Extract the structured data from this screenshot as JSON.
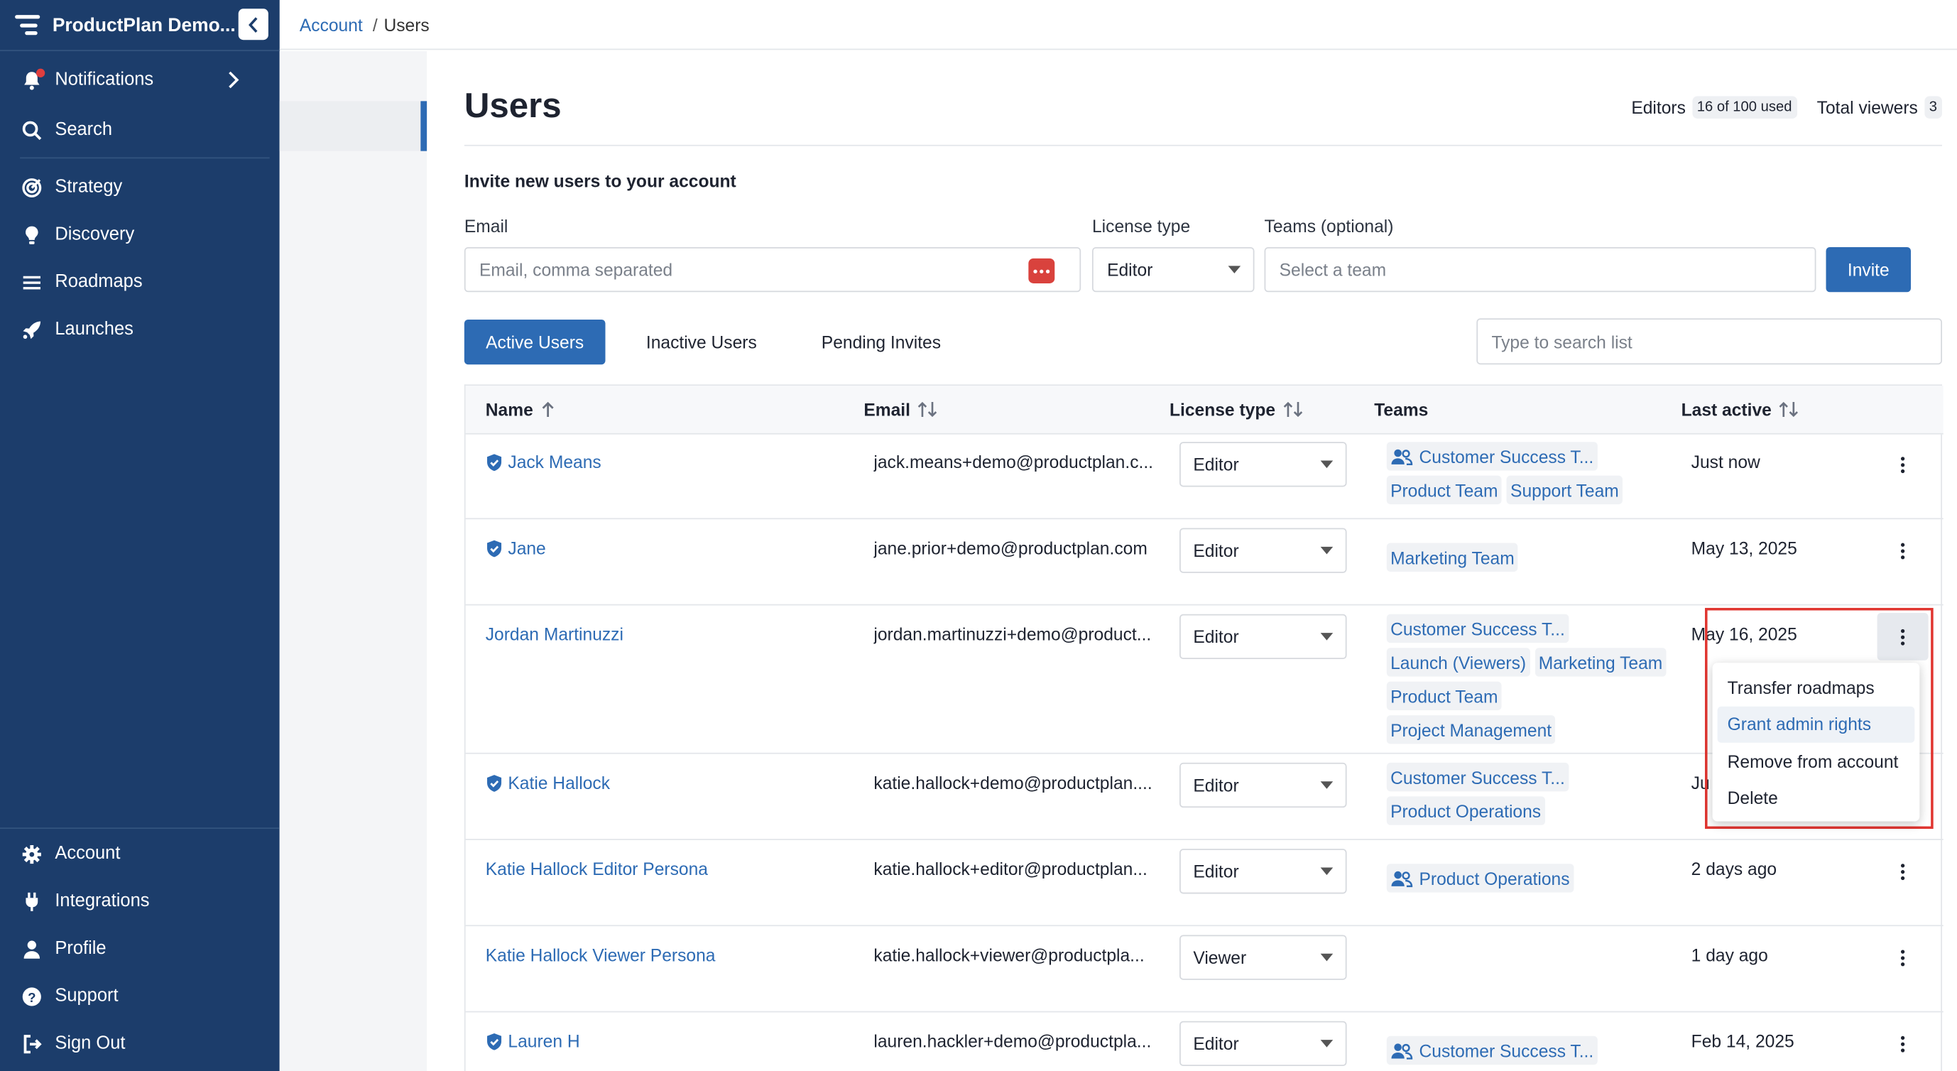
{
  "app": {
    "name": "ProductPlan Demo..."
  },
  "nav": {
    "top": [
      {
        "label": "Notifications",
        "icon": "bell-icon"
      },
      {
        "label": "Search",
        "icon": "search-icon"
      }
    ],
    "main": [
      {
        "label": "Strategy",
        "icon": "target-icon"
      },
      {
        "label": "Discovery",
        "icon": "lightbulb-icon"
      },
      {
        "label": "Roadmaps",
        "icon": "roadmap-lines-icon"
      },
      {
        "label": "Launches",
        "icon": "rocket-icon"
      }
    ],
    "bottom": [
      {
        "label": "Account",
        "icon": "gear-icon"
      },
      {
        "label": "Integrations",
        "icon": "plug-icon"
      },
      {
        "label": "Profile",
        "icon": "person-icon"
      },
      {
        "label": "Support",
        "icon": "help-icon"
      },
      {
        "label": "Sign Out",
        "icon": "sign-out-icon"
      }
    ]
  },
  "breadcrumb": {
    "parent": "Account",
    "separator": "/",
    "current": "Users"
  },
  "page": {
    "title": "Users"
  },
  "stats": {
    "editors_label": "Editors",
    "editors_value": "16 of 100 used",
    "viewers_label": "Total viewers",
    "viewers_value": "3"
  },
  "invite": {
    "title": "Invite new users to your account",
    "email_label": "Email",
    "email_placeholder": "Email, comma separated",
    "license_label": "License type",
    "license_value": "Editor",
    "teams_label": "Teams (optional)",
    "teams_placeholder": "Select a team",
    "button": "Invite"
  },
  "tabs": [
    "Active Users",
    "Inactive Users",
    "Pending Invites"
  ],
  "search": {
    "placeholder": "Type to search list"
  },
  "table": {
    "headers": {
      "name": "Name",
      "email": "Email",
      "license": "License type",
      "teams": "Teams",
      "last": "Last active"
    },
    "rows": [
      {
        "name": "Jack Means",
        "admin": true,
        "email": "jack.means+demo@productplan.c...",
        "license": "Editor",
        "teams": [
          {
            "label": "Customer Success T...",
            "icon": true
          },
          {
            "label": "Product Team"
          },
          {
            "label": "Support Team"
          }
        ],
        "last": "Just now"
      },
      {
        "name": "Jane",
        "admin": true,
        "email": "jane.prior+demo@productplan.com",
        "license": "Editor",
        "teams": [
          {
            "label": "Marketing Team"
          }
        ],
        "last": "May 13, 2025"
      },
      {
        "name": "Jordan Martinuzzi",
        "admin": false,
        "email": "jordan.martinuzzi+demo@product...",
        "license": "Editor",
        "teams": [
          {
            "label": "Customer Success T..."
          },
          {
            "label": "Launch (Viewers)"
          },
          {
            "label": "Marketing Team"
          },
          {
            "label": "Product Team"
          },
          {
            "label": "Project Management"
          }
        ],
        "last": "May 16, 2025"
      },
      {
        "name": "Katie Hallock",
        "admin": true,
        "email": "katie.hallock+demo@productplan....",
        "license": "Editor",
        "teams": [
          {
            "label": "Customer Success T..."
          },
          {
            "label": "Product Operations"
          }
        ],
        "last": "Ju"
      },
      {
        "name": "Katie Hallock Editor Persona",
        "admin": false,
        "email": "katie.hallock+editor@productplan...",
        "license": "Editor",
        "teams": [
          {
            "label": "Product Operations",
            "icon": true
          }
        ],
        "last": "2 days ago"
      },
      {
        "name": "Katie Hallock Viewer Persona",
        "admin": false,
        "email": "katie.hallock+viewer@productpla...",
        "license": "Viewer",
        "teams": [],
        "last": "1 day ago"
      },
      {
        "name": "Lauren H",
        "admin": true,
        "email": "lauren.hackler+demo@productpla...",
        "license": "Editor",
        "teams": [
          {
            "label": "Customer Success T...",
            "icon": true
          }
        ],
        "last": "Feb 14, 2025"
      }
    ]
  },
  "row_menu": {
    "items": [
      "Transfer roadmaps",
      "Grant admin rights",
      "Remove from account",
      "Delete"
    ],
    "hovered": "Grant admin rights"
  }
}
